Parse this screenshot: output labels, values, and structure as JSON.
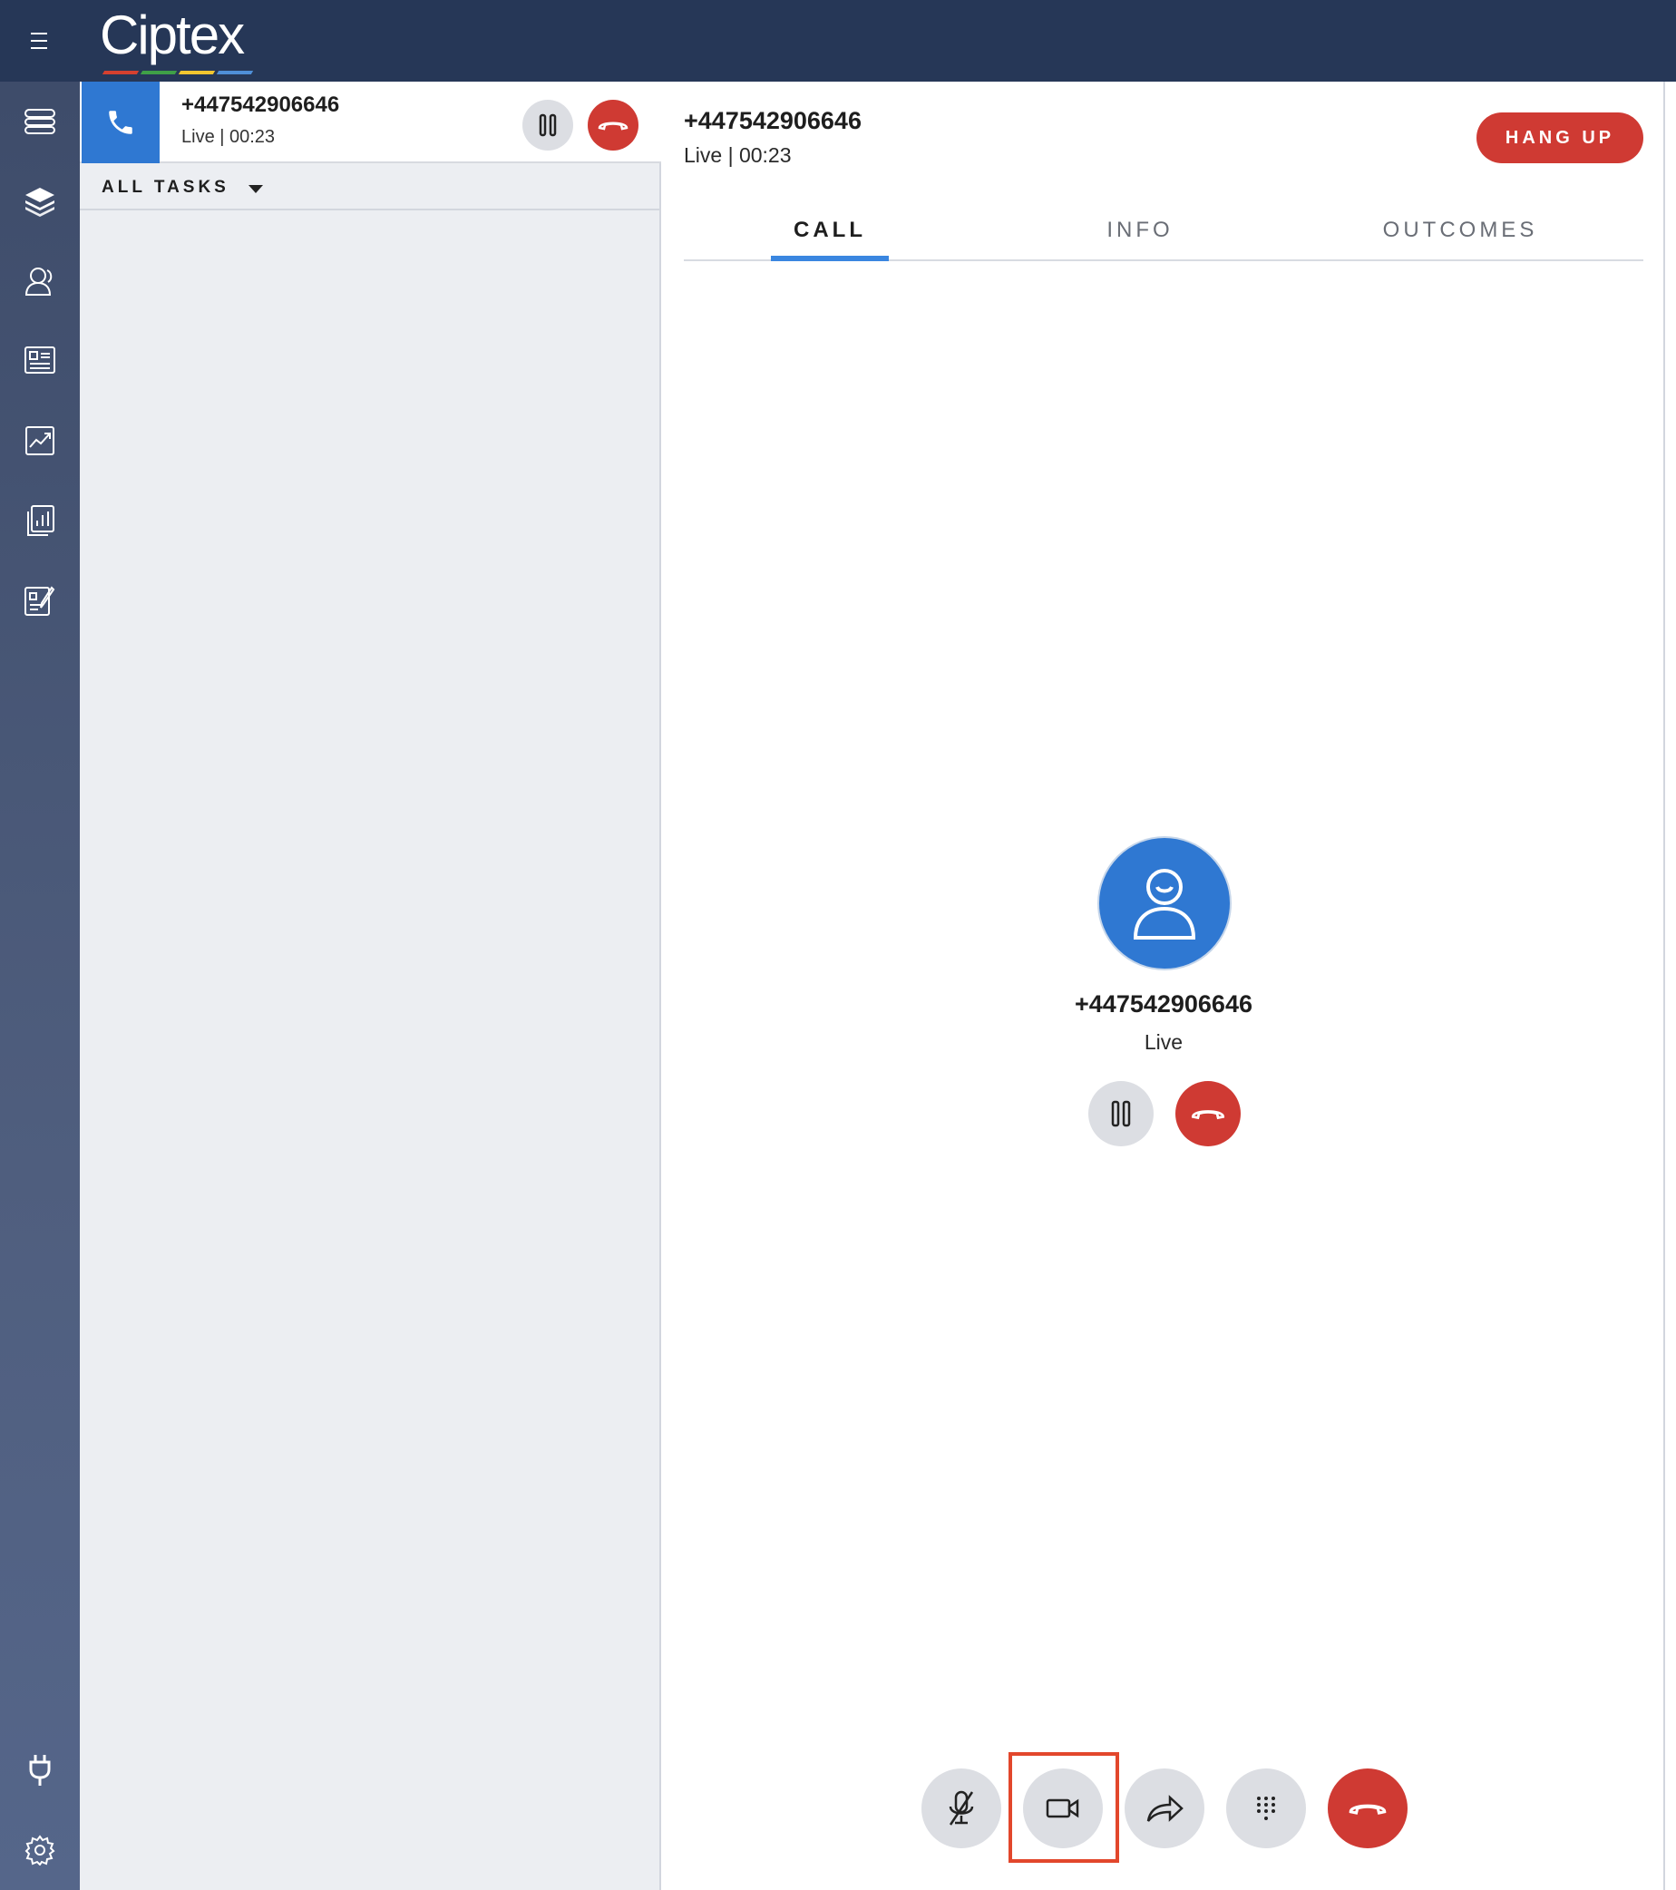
{
  "app": {
    "logo_text": "Ciptex",
    "logo_bar_colors": [
      "#d5402f",
      "#3fa047",
      "#f2c630",
      "#4f8fd8"
    ]
  },
  "nav": {
    "items": [
      "queues-icon",
      "layers-icon",
      "contacts-icon",
      "directory-icon",
      "analytics-icon",
      "reports-icon",
      "forms-icon"
    ],
    "bottom": [
      "plug-icon",
      "settings-icon"
    ]
  },
  "task": {
    "number": "+447542906646",
    "status": "Live | 00:23"
  },
  "filter": {
    "label": "ALL TASKS"
  },
  "call": {
    "number": "+447542906646",
    "status": "Live | 00:23",
    "hangup_label": "HANG UP",
    "tabs": [
      {
        "label": "CALL",
        "active": true
      },
      {
        "label": "INFO",
        "active": false
      },
      {
        "label": "OUTCOMES",
        "active": false
      }
    ],
    "caller_number": "+447542906646",
    "caller_status": "Live",
    "controls": [
      "mute-icon",
      "video-icon",
      "transfer-icon",
      "dialpad-icon",
      "hangup-icon"
    ],
    "highlighted_control": "video-icon"
  },
  "colors": {
    "header": "#263757",
    "accent_blue": "#2f78d2",
    "danger_red": "#cf3a33",
    "highlight_box": "#e2472c"
  }
}
